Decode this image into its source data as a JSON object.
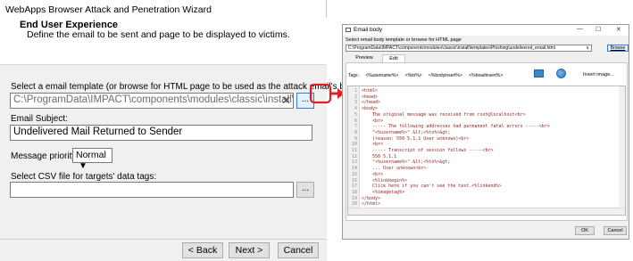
{
  "wizard": {
    "title": "WebApps Browser Attack and Penetration Wizard",
    "header_title": "End User Experience",
    "header_subtitle": "Define the email to be sent and page to be displayed to victims.",
    "template_label": "Select a email template (or browse for HTML page to be used as the attack email's body):",
    "template_path": "C:\\ProgramData\\IMPACT\\components\\modules\\classic\\install\\te",
    "ellipsis": "...",
    "subject_label": "Email Subject:",
    "subject_value": "Undelivered Mail Returned to Sender",
    "priority_label": "Message priority:",
    "priority_value": "Normal",
    "csv_label": "Select CSV file for targets' data tags:",
    "csv_value": "",
    "back_button": "< Back",
    "next_button": "Next >",
    "cancel_button": "Cancel"
  },
  "dialog": {
    "title": "Email body",
    "minimize": "—",
    "maximize": "☐",
    "close": "✕",
    "instruction": "Select email body template or browse for HTML page",
    "path": "C:\\ProgramData\\IMPACT\\components\\modules\\classic\\install\\templates\\Phishing\\undelivered_email.html",
    "browse_button": "Browse",
    "tabs": [
      "Preview",
      "Edit"
    ],
    "active_tab": "Edit",
    "tags_label": "Tags:",
    "tags": [
      "<%username%>",
      "<%to%>",
      "<%bodyinsert%>",
      "<%headinsert%>"
    ],
    "insert_image": "Insert image...",
    "code_lines": [
      {
        "n": "1",
        "text": "<html>"
      },
      {
        "n": "2",
        "text": "<head>"
      },
      {
        "n": "3",
        "text": "</head>"
      },
      {
        "n": "4",
        "text": "<body>"
      },
      {
        "n": "5",
        "text": "    The original message was received from root@localhost<br>"
      },
      {
        "n": "6",
        "text": "    <br>"
      },
      {
        "n": "7",
        "text": "    ----- The following addresses had permanent fatal errors -----<br>"
      },
      {
        "n": "8",
        "text": "    \"<%username%>\" &lt;<%to%>&gt;"
      },
      {
        "n": "9",
        "text": "    (reason: 550 5.1.1 User unknown)<br>"
      },
      {
        "n": "10",
        "text": "    <br>"
      },
      {
        "n": "11",
        "text": "    ----- Transcript of session follows -----<br>"
      },
      {
        "n": "12",
        "text": "    550 5.1.1"
      },
      {
        "n": "13",
        "text": "    \"<%username%>\" &lt;<%to%>&gt;"
      },
      {
        "n": "14",
        "text": "    ... User unknown<br>"
      },
      {
        "n": "15",
        "text": "    <br>"
      },
      {
        "n": "16",
        "text": "    <%linkbegin%>"
      },
      {
        "n": "17",
        "text": "    Click here if you can't see the text.<%linkend%>"
      },
      {
        "n": "18",
        "text": "    <%imagetag%>"
      },
      {
        "n": "19",
        "text": "</body>"
      },
      {
        "n": "20",
        "text": "</html>"
      }
    ],
    "ok_button": "OK",
    "cancel_button": "Cancel"
  },
  "colors": {
    "arrow": "#e02020",
    "focus_border": "#3a78d8",
    "code_text": "#9b2020"
  }
}
